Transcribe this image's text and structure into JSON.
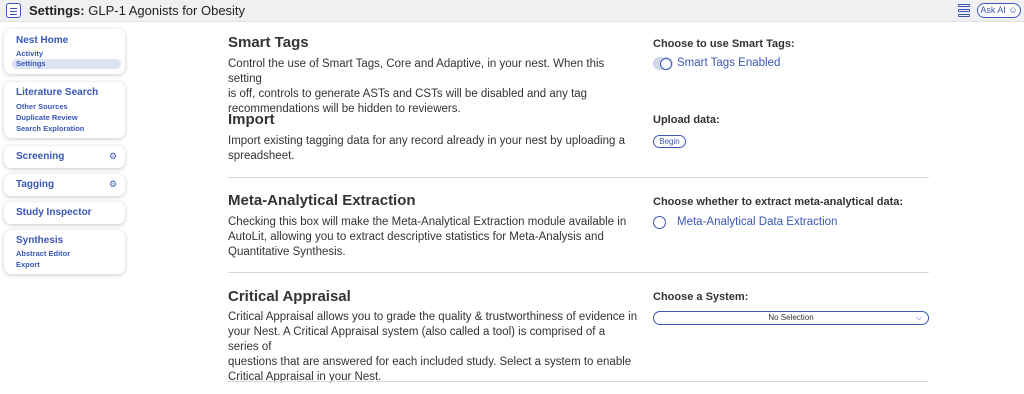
{
  "topbar": {
    "title_prefix": "Settings:",
    "title": "GLP-1 Agonists for Obesity",
    "ask_ai_label": "Ask AI"
  },
  "sidebar": {
    "nest_home": {
      "label": "Nest Home",
      "items": [
        "Activity",
        "Settings"
      ]
    },
    "literature_search": {
      "label": "Literature Search",
      "items": [
        "Other Sources",
        "Duplicate Review",
        "Search Exploration"
      ]
    },
    "screening": {
      "label": "Screening"
    },
    "tagging": {
      "label": "Tagging"
    },
    "study_inspector": {
      "label": "Study Inspector"
    },
    "synthesis": {
      "label": "Synthesis",
      "items": [
        "Abstract Editor",
        "Export"
      ]
    }
  },
  "sections": {
    "smart_tags": {
      "title": "Smart Tags",
      "desc_lines": [
        "Control the use of Smart Tags, Core and Adaptive, in your nest. When this setting",
        "is off, controls to generate ASTs and CSTs will be disabled and any tag",
        "recommendations will be hidden to reviewers."
      ],
      "option_label": "Choose to use Smart Tags:",
      "toggle_label": "Smart Tags Enabled"
    },
    "import": {
      "title": "Import",
      "desc_lines": [
        "Import existing tagging data for any record already in your nest by uploading a",
        "spreadsheet."
      ],
      "option_label": "Upload data:",
      "button_label": "Begin"
    },
    "meta": {
      "title": "Meta-Analytical Extraction",
      "desc_lines": [
        "Checking this box will make the Meta-Analytical Extraction module available in",
        "AutoLit, allowing you to extract descriptive statistics for Meta-Analysis and",
        "Quantitative Synthesis."
      ],
      "option_label": "Choose whether to extract meta-analytical data:",
      "radio_label": "Meta-Analytical Data Extraction"
    },
    "critical": {
      "title": "Critical Appraisal",
      "desc_lines": [
        "Critical Appraisal allows you to grade the quality & trustworthiness of evidence in",
        "your Nest. A Critical Appraisal system (also called a tool) is comprised of a series of",
        "questions that are answered for each included study. Select a system to enable",
        "Critical Appraisal in your Nest."
      ],
      "option_label": "Choose a System:",
      "select_value": "No Selection"
    }
  },
  "colors": {
    "accent": "#3a57b5",
    "active_bg": "#dde3f3",
    "topbar_bg": "#f0f0f3"
  }
}
